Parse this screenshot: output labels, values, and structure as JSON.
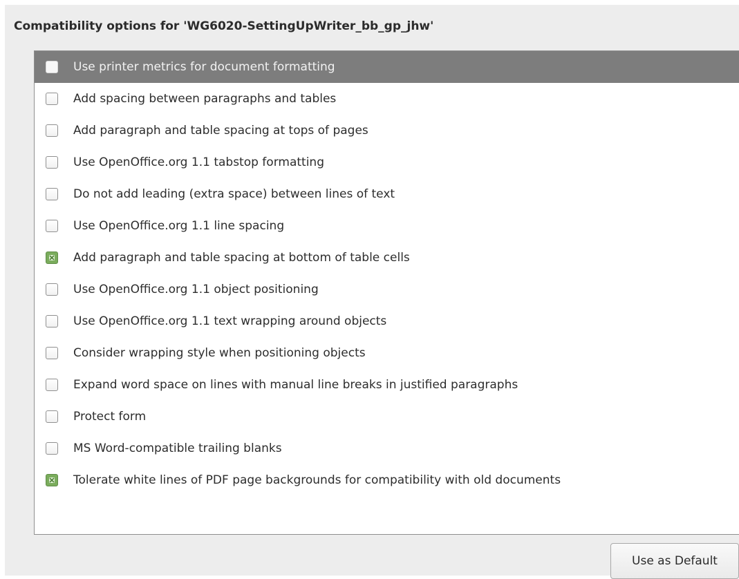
{
  "panel": {
    "title": "Compatibility options for 'WG6020-SettingUpWriter_bb_gp_jhw'"
  },
  "options": [
    {
      "label": "Use printer metrics for document formatting",
      "checked": false,
      "selected": true
    },
    {
      "label": "Add spacing between paragraphs and tables",
      "checked": false,
      "selected": false
    },
    {
      "label": "Add paragraph and table spacing at tops of pages",
      "checked": false,
      "selected": false
    },
    {
      "label": "Use OpenOffice.org 1.1 tabstop formatting",
      "checked": false,
      "selected": false
    },
    {
      "label": "Do not add leading (extra space) between lines of text",
      "checked": false,
      "selected": false
    },
    {
      "label": "Use OpenOffice.org 1.1 line spacing",
      "checked": false,
      "selected": false
    },
    {
      "label": "Add paragraph and table spacing at bottom of table cells",
      "checked": true,
      "selected": false
    },
    {
      "label": "Use OpenOffice.org 1.1 object positioning",
      "checked": false,
      "selected": false
    },
    {
      "label": "Use OpenOffice.org 1.1 text wrapping around objects",
      "checked": false,
      "selected": false
    },
    {
      "label": "Consider wrapping style when positioning objects",
      "checked": false,
      "selected": false
    },
    {
      "label": "Expand word space on lines with manual line breaks in justified paragraphs",
      "checked": false,
      "selected": false
    },
    {
      "label": "Protect form",
      "checked": false,
      "selected": false
    },
    {
      "label": "MS Word-compatible trailing blanks",
      "checked": false,
      "selected": false
    },
    {
      "label": "Tolerate white lines of PDF page backgrounds for compatibility with old documents",
      "checked": true,
      "selected": false
    }
  ],
  "buttons": {
    "use_as_default": "Use as Default"
  },
  "colors": {
    "panel_background": "#ededed",
    "selected_row": "#7d7d7d",
    "checked_box": "#7aac5c"
  }
}
